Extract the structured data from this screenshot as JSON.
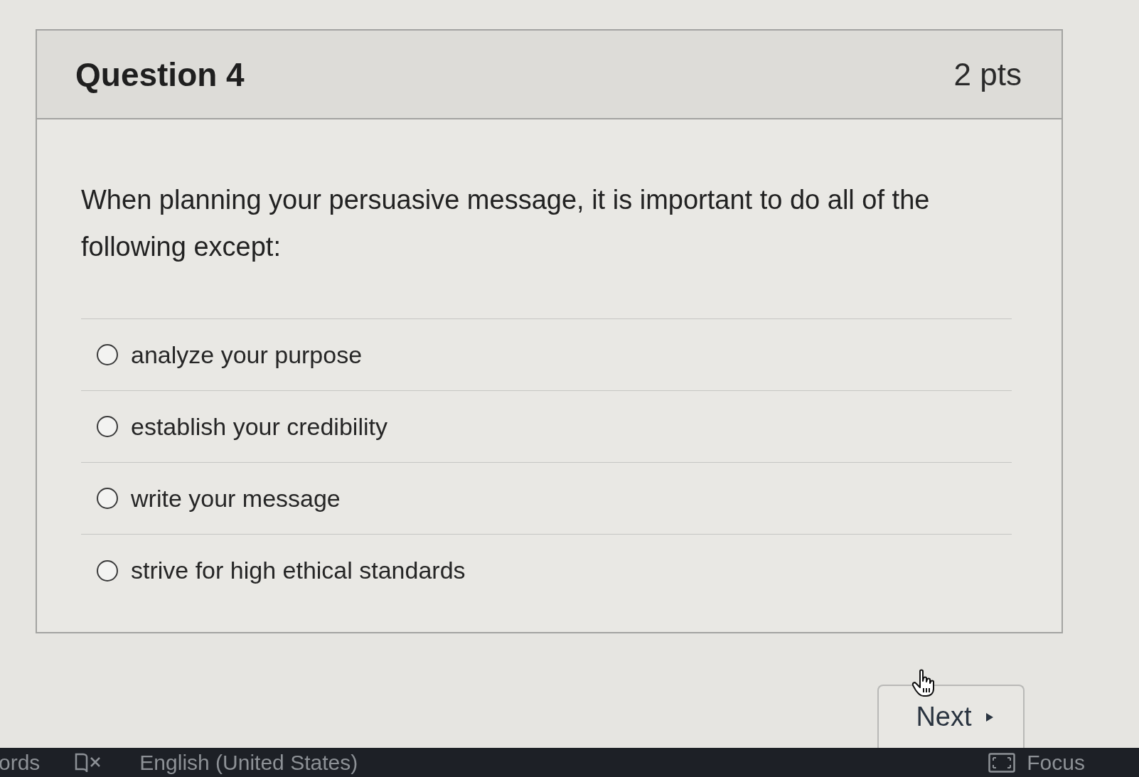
{
  "question": {
    "title": "Question 4",
    "points": "2 pts",
    "text": "When planning your persuasive message, it is important to do all of the following except:",
    "answers": [
      {
        "label": "analyze your purpose",
        "selected": false
      },
      {
        "label": "establish your credibility",
        "selected": false
      },
      {
        "label": "write your message",
        "selected": false
      },
      {
        "label": "strive for high ethical standards",
        "selected": false
      }
    ]
  },
  "next_button": {
    "label": "Next"
  },
  "status_bar": {
    "word_count_label": "ords",
    "language": "English (United States)",
    "focus_label": "Focus"
  }
}
